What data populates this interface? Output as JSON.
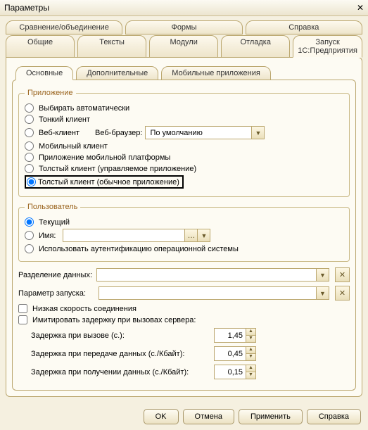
{
  "window": {
    "title": "Параметры"
  },
  "tabs_row1": [
    "Сравнение/объединение",
    "Формы",
    "Справка"
  ],
  "tabs_row2": [
    "Общие",
    "Тексты",
    "Модули",
    "Отладка",
    "Запуск 1С:Предприятия"
  ],
  "tabs_row2_active": 4,
  "tabs_row3": [
    "Основные",
    "Дополнительные",
    "Мобильные приложения"
  ],
  "tabs_row3_active": 0,
  "app_group": {
    "legend": "Приложение",
    "radios": {
      "auto": "Выбирать автоматически",
      "thin": "Тонкий клиент",
      "web": "Веб-клиент",
      "mobile": "Мобильный клиент",
      "mobileapp": "Приложение мобильной платформы",
      "thick_managed": "Толстый клиент (управляемое приложение)",
      "thick_ordinary": "Толстый клиент (обычное приложение)"
    },
    "web_browser_label": "Веб-браузер:",
    "web_browser_value": "По умолчанию"
  },
  "user_group": {
    "legend": "Пользователь",
    "radios": {
      "current": "Текущий",
      "name": "Имя:"
    },
    "use_os_auth": "Использовать аутентификацию операционной системы"
  },
  "fields": {
    "data_split_label": "Разделение данных:",
    "launch_param_label": "Параметр запуска:"
  },
  "checks": {
    "low_speed": "Низкая скорость соединения",
    "emulate_delay": "Имитировать задержку при вызовах сервера:"
  },
  "delays": {
    "call_label": "Задержка при вызове (с.):",
    "call_value": "1,45",
    "send_label": "Задержка при передаче данных (с./Кбайт):",
    "send_value": "0,45",
    "recv_label": "Задержка при получении данных (с./Кбайт):",
    "recv_value": "0,15"
  },
  "buttons": {
    "ok": "OK",
    "cancel": "Отмена",
    "apply": "Применить",
    "help": "Справка"
  }
}
